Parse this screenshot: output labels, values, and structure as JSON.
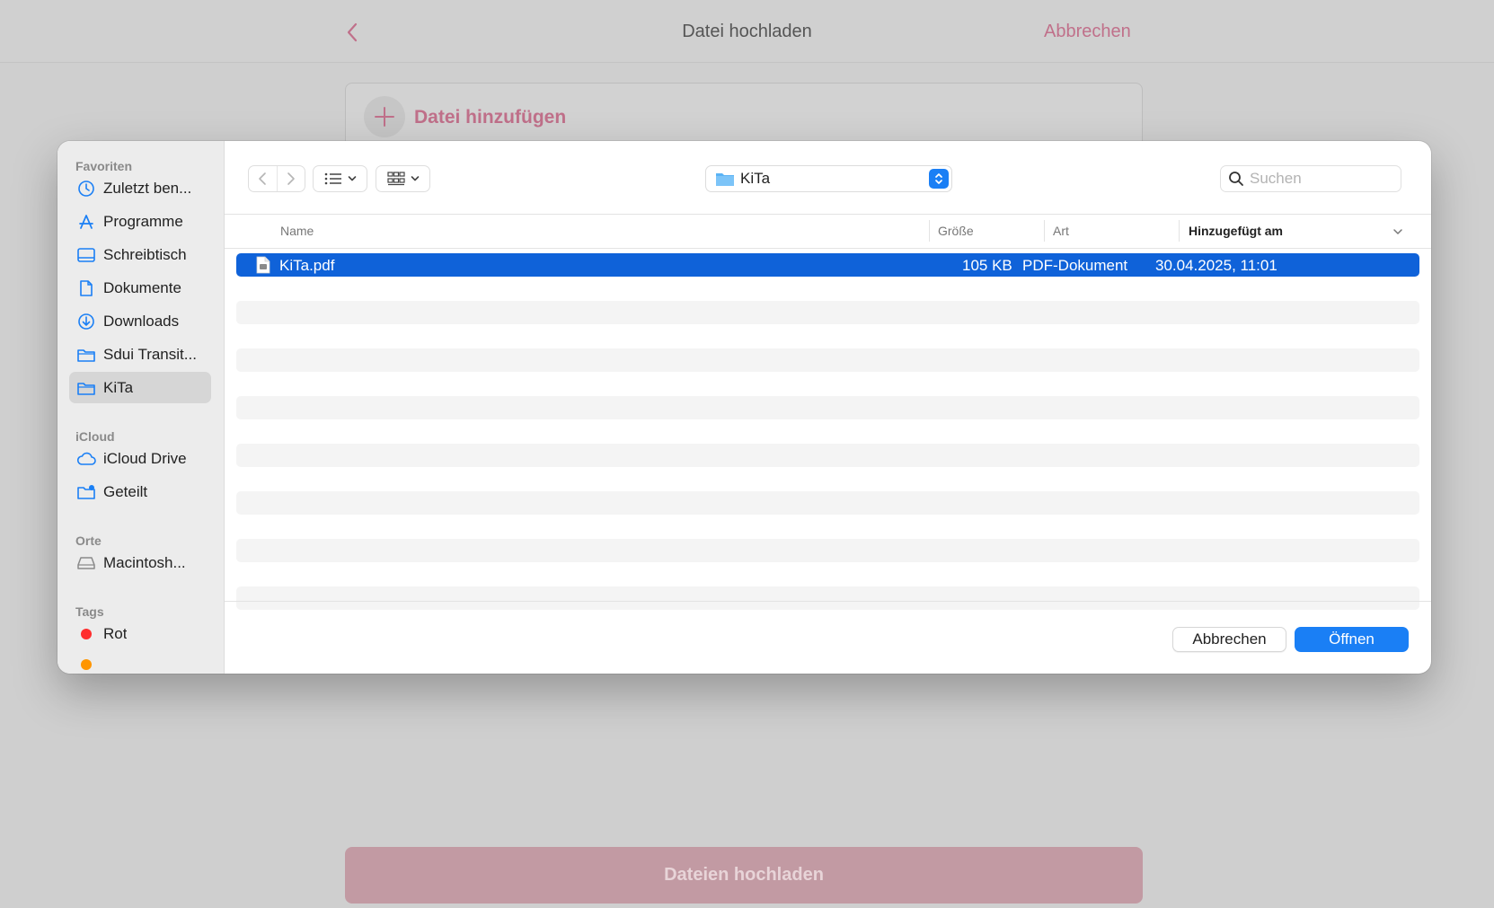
{
  "app": {
    "title": "Datei hochladen",
    "cancel_label": "Abbrechen",
    "add_file_label": "Datei hinzufügen",
    "upload_button_label": "Dateien hochladen",
    "accent_color": "#c0708a"
  },
  "dialog": {
    "sidebar": {
      "sections": [
        {
          "title": "Favoriten",
          "items": [
            {
              "label": "Zuletzt ben...",
              "icon": "clock-icon"
            },
            {
              "label": "Programme",
              "icon": "apps-icon"
            },
            {
              "label": "Schreibtisch",
              "icon": "desktop-icon"
            },
            {
              "label": "Dokumente",
              "icon": "document-icon"
            },
            {
              "label": "Downloads",
              "icon": "download-icon"
            },
            {
              "label": "Sdui Transit...",
              "icon": "folder-icon"
            },
            {
              "label": "KiTa",
              "icon": "folder-icon",
              "selected": true
            }
          ]
        },
        {
          "title": "iCloud",
          "items": [
            {
              "label": "iCloud Drive",
              "icon": "cloud-icon"
            },
            {
              "label": "Geteilt",
              "icon": "shared-folder-icon"
            }
          ]
        },
        {
          "title": "Orte",
          "items": [
            {
              "label": "Macintosh...",
              "icon": "disk-icon"
            }
          ]
        },
        {
          "title": "Tags",
          "items": [
            {
              "label": "Rot",
              "icon": "tag-dot",
              "color": "#ff2d2d"
            }
          ]
        }
      ]
    },
    "toolbar": {
      "path_label": "KiTa",
      "search_placeholder": "Suchen"
    },
    "columns": {
      "name": "Name",
      "size": "Größe",
      "kind": "Art",
      "date_added": "Hinzugefügt am"
    },
    "files": [
      {
        "name": "KiTa.pdf",
        "size": "105 KB",
        "kind": "PDF-Dokument",
        "date_added": "30.04.2025, 11:01",
        "selected": true
      }
    ],
    "buttons": {
      "cancel": "Abbrechen",
      "open": "Öffnen"
    },
    "selection_color": "#0f62d9",
    "primary_color": "#1a7ff5"
  }
}
